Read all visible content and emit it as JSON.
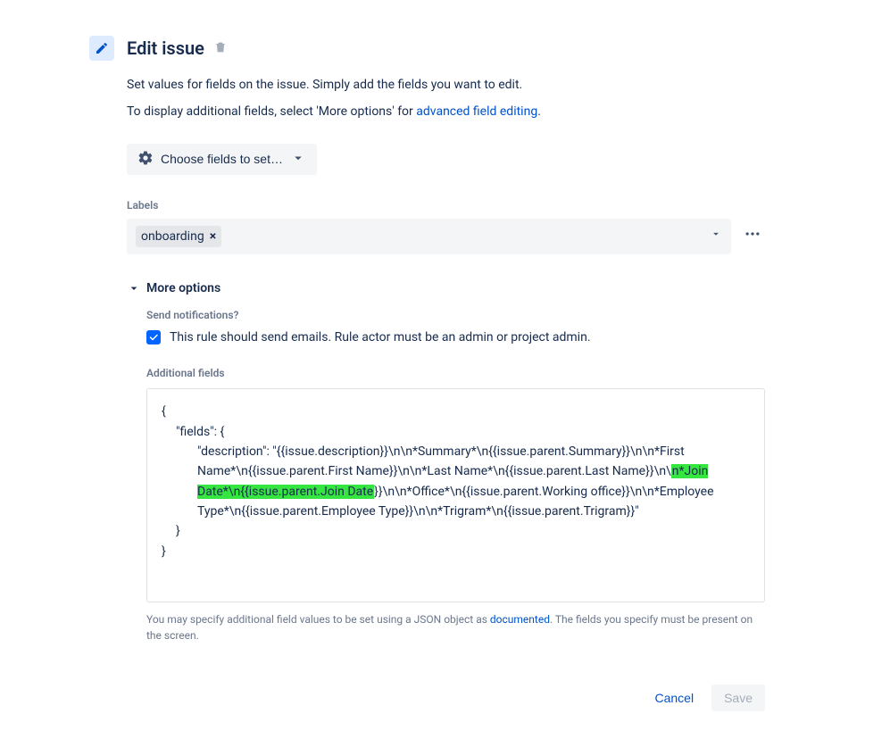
{
  "header": {
    "title": "Edit issue"
  },
  "intro": {
    "line1": "Set values for fields on the issue. Simply add the fields you want to edit.",
    "line2_prefix": "To display additional fields, select 'More options' for ",
    "line2_link": "advanced field editing",
    "line2_suffix": "."
  },
  "choose_fields_label": "Choose fields to set…",
  "labels": {
    "label": "Labels",
    "tag": "onboarding"
  },
  "more_options": {
    "label": "More options",
    "send_notifications_label": "Send notifications?",
    "send_notifications_text": "This rule should send emails. Rule actor must be an admin or project admin.",
    "additional_fields_label": "Additional fields",
    "code_parts": {
      "p1": "{",
      "p2": "\"fields\": {",
      "p3a": "\"description\": \"{{issue.description}}\\n\\n*Summary*\\n{{issue.parent.Summary}}\\n\\n*First Name*\\n{{issue.parent.First Name}}\\n\\n*Last Name*\\n{{issue.parent.Last Name}}\\n\\",
      "p3b_hl": "n*Join Date*\\n{{issue.parent.Join Date",
      "p3c": "}}\\n\\n*Office*\\n{{issue.parent.Working office}}\\n\\n*Employee Type*\\n{{issue.parent.Employee Type}}\\n\\n*Trigram*\\n{{issue.parent.Trigram}}\"",
      "p4": "}",
      "p5": "}"
    },
    "hint_prefix": "You may specify additional field values to be set using a JSON object as ",
    "hint_link": "documented",
    "hint_suffix": ". The fields you specify must be present on the screen."
  },
  "footer": {
    "cancel": "Cancel",
    "save": "Save"
  }
}
